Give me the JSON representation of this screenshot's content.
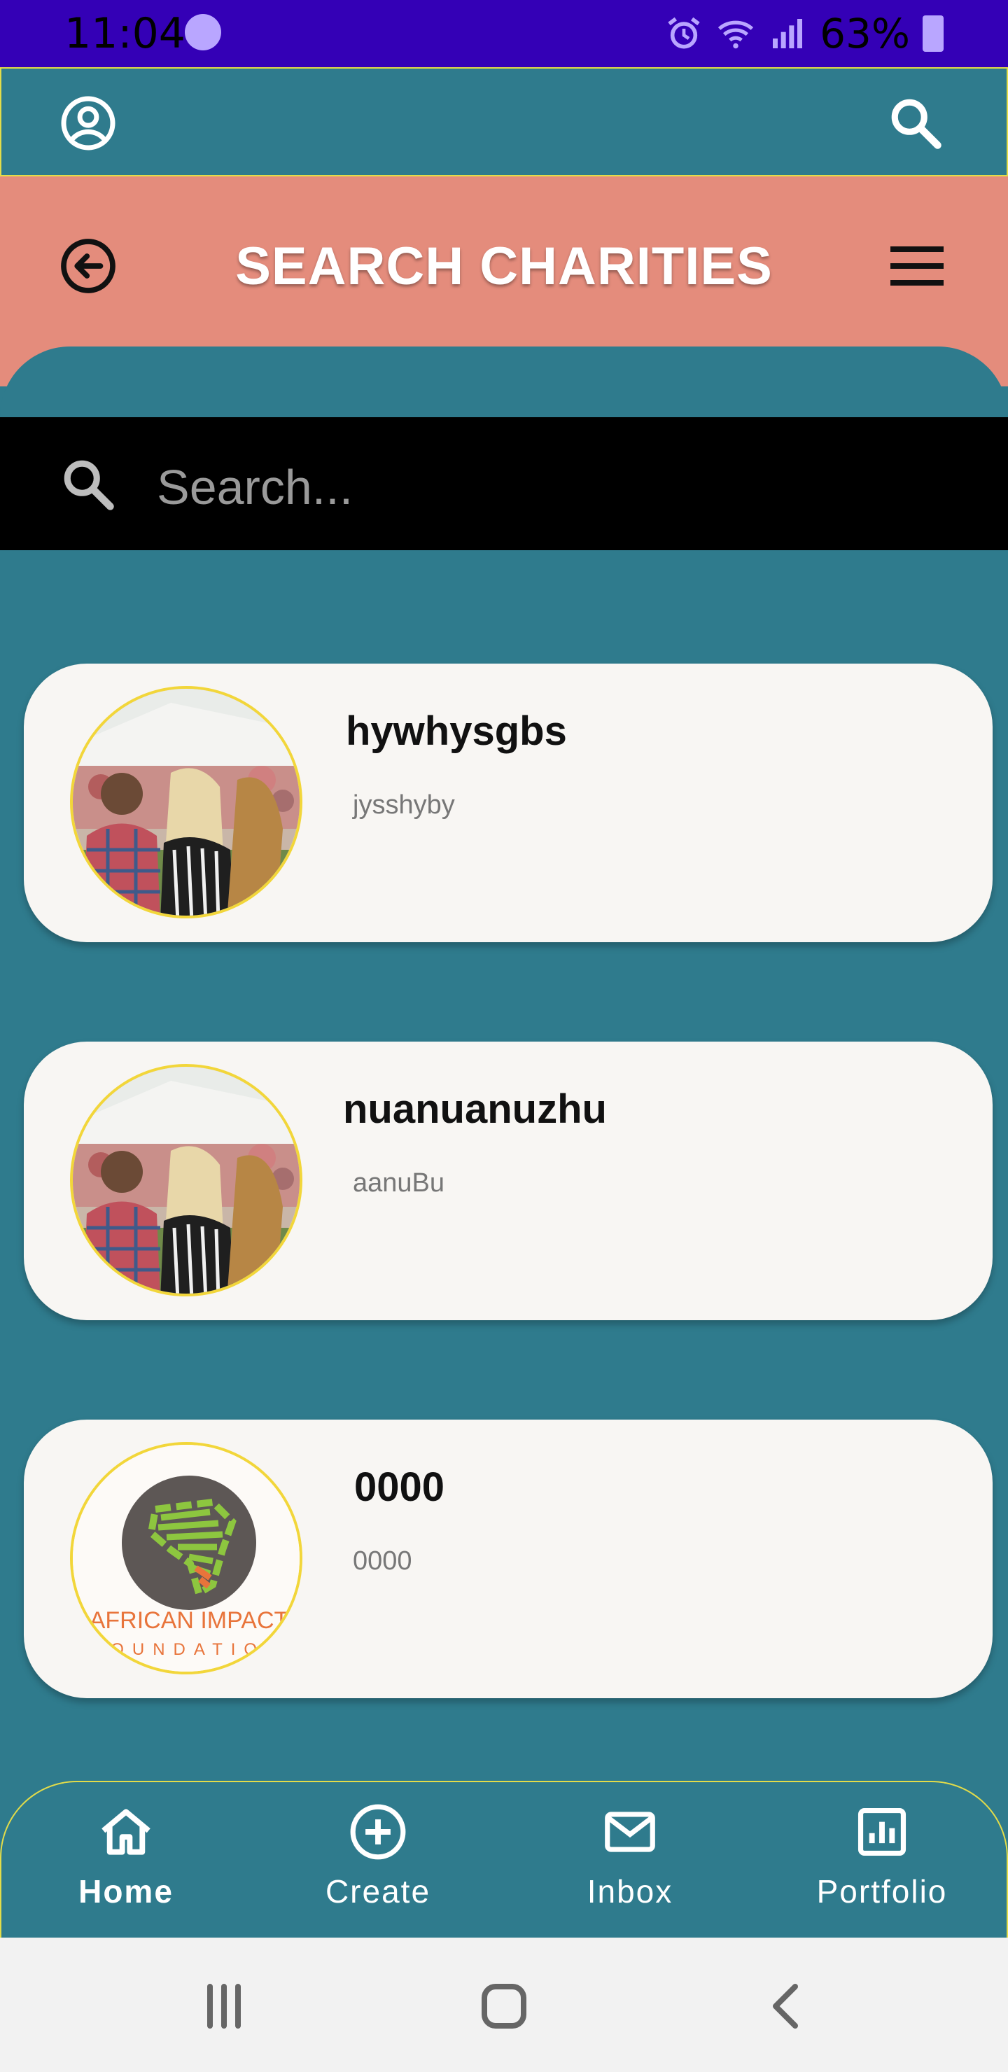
{
  "status_bar": {
    "time": "11:04",
    "battery": "63%"
  },
  "header": {
    "title": "SEARCH CHARITIES"
  },
  "search": {
    "placeholder": "Search..."
  },
  "charities": [
    {
      "name": "hywhysgbs",
      "subtitle": "jysshyby",
      "image": "people-crowd-photo"
    },
    {
      "name": "nuanuanuzhu",
      "subtitle": "aanuBu",
      "image": "people-crowd-photo"
    },
    {
      "name": "0000",
      "subtitle": "0000",
      "image": "african-impact-foundation-logo",
      "logo_text_1": "AFRICAN IMPACT",
      "logo_text_2": "FOUNDATION"
    }
  ],
  "bottom_nav": {
    "items": [
      {
        "label": "Home",
        "icon": "home-icon",
        "active": true
      },
      {
        "label": "Create",
        "icon": "plus-circle-icon",
        "active": false
      },
      {
        "label": "Inbox",
        "icon": "mail-icon",
        "active": false
      },
      {
        "label": "Portfolio",
        "icon": "chart-icon",
        "active": false
      }
    ]
  },
  "colors": {
    "status_bar": "#3400b6",
    "teal": "#2f7b8d",
    "salmon": "#e48c7c",
    "card": "#f8f6f3",
    "avatar_border": "#f2d63a"
  }
}
